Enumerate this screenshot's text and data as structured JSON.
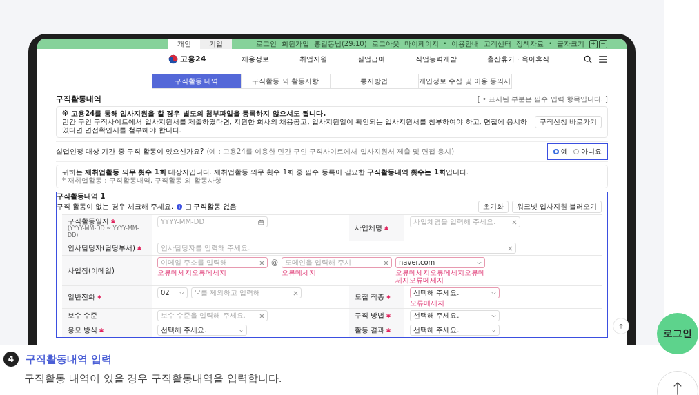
{
  "util_bar": {
    "tabs": [
      {
        "label": "개인",
        "selected": true
      },
      {
        "label": "기업",
        "selected": false
      }
    ],
    "links": [
      {
        "kind": "link",
        "text": "로그인"
      },
      {
        "kind": "link",
        "text": "회원가입"
      },
      {
        "kind": "link",
        "text": "홍길동님(29:10)"
      },
      {
        "kind": "link",
        "text": "로그아웃"
      },
      {
        "kind": "link",
        "text": "마이페이지"
      },
      {
        "kind": "dot",
        "text": "•"
      },
      {
        "kind": "link",
        "text": "이용안내"
      },
      {
        "kind": "link",
        "text": "고객센터"
      },
      {
        "kind": "link",
        "text": "정책자료"
      },
      {
        "kind": "dot",
        "text": "•"
      },
      {
        "kind": "link",
        "text": "글자크기"
      }
    ],
    "font_buttons": [
      "+",
      "−"
    ]
  },
  "header": {
    "logo": "고용24",
    "nav": [
      "채용정보",
      "취업지원",
      "실업급여",
      "직업능력개발",
      "출산휴가 · 육아휴직"
    ]
  },
  "tabs": [
    {
      "label": "구직활동 내역",
      "selected": true
    },
    {
      "label": "구직활동 외 활동사항",
      "selected": false
    },
    {
      "label": "통지방법",
      "selected": false
    },
    {
      "label": "개인정보 수집 및 이용 동의서",
      "selected": false
    }
  ],
  "section": {
    "title": "구직활동내역",
    "required_note": "[ • 표시된 부분은 필수 입력 항목입니다. ]"
  },
  "notice": {
    "headline": "※ 고용24를 통해 입사지원을 할 경우 별도의 첨부파일을 등록하지 않으셔도 됩니다.",
    "body": "민간 구인 구직사이트에서 입사지원서를 제출하였다면, 지원한 회사의 채용공고, 입사지원일이 확인되는 입사지원서를 첨부하여야 하고, 면접에 응시하였다면 면접확인서를 첨부해야 합니다.",
    "button": "구직신청 바로가기"
  },
  "question": {
    "text": "실업인정 대상 기간 중 구직 활동이 있으신가요?",
    "example": "(예 : 고용24를 이용한 민간 구인 구직사이트에서 입사지원서 제출 및 면접 응시)",
    "options": [
      {
        "label": "예",
        "selected": true
      },
      {
        "label": "아니요",
        "selected": false
      }
    ]
  },
  "info": {
    "text": "귀하는 **재취업활동 의무 횟수 1회** 대상자입니다. 재취업활동 의무 횟수 1회 중 필수 등록이 필요한 **구직활동내역 횟수는 1회**입니다.",
    "footnote": "* 재취업활동 : 구직활동내역, 구직활동 외 활동사항"
  },
  "form": {
    "title": "구직활동내역 1",
    "hint": "구직 활동이 없는 경우 체크해 주세요.",
    "no_activity": {
      "label": "구직활동 없음",
      "checked": false
    },
    "buttons": [
      "초기화",
      "워크넷 입사지원 불러오기"
    ],
    "rows": [
      {
        "cells": [
          {
            "label": "구직활동일자",
            "required": true,
            "sublabel": "(YYYY-MM-DD ~ YYYY-MM-DD)",
            "controls": [
              {
                "kind": "date",
                "placeholder": "YYYY-MM-DD"
              }
            ]
          },
          {
            "label": "사업체명",
            "required": true,
            "controls": [
              {
                "kind": "text",
                "placeholder": "사업체명을 입력해 주세요."
              }
            ]
          }
        ]
      },
      {
        "cells": [
          {
            "label": "인사담당자(담당부서)",
            "required": true,
            "controls": [
              {
                "kind": "text",
                "placeholder": "인사담당자를 입력해 주세요."
              }
            ]
          }
        ]
      },
      {
        "cells": [
          {
            "label": "사업장(이메일)",
            "required": false,
            "controls": [
              {
                "kind": "text",
                "placeholder": "이메일 주소를 입력해",
                "error": "오류메세지오류메세지"
              },
              {
                "kind": "separator",
                "text": "@"
              },
              {
                "kind": "text",
                "placeholder": "도메인을 입력해 주시",
                "error": "오류메세지"
              },
              {
                "kind": "select",
                "value": "naver.com",
                "error": "오류메세지오류메세지오류메세지오류메세지"
              }
            ]
          }
        ]
      },
      {
        "cells": [
          {
            "label": "일반전화",
            "required": true,
            "controls": [
              {
                "kind": "select",
                "value": "02"
              },
              {
                "kind": "text",
                "placeholder": "'-'를 제외하고 입력해"
              }
            ]
          },
          {
            "label": "모집 직종",
            "required": true,
            "controls": [
              {
                "kind": "select",
                "value": "선택해 주세요.",
                "error": "오류메세지"
              }
            ]
          }
        ]
      },
      {
        "cells": [
          {
            "label": "보수 수준",
            "required": false,
            "controls": [
              {
                "kind": "text",
                "placeholder": "보수 수준을 입력해 주세요."
              }
            ]
          },
          {
            "label": "구직 방법",
            "required": true,
            "controls": [
              {
                "kind": "select",
                "value": "선택해 주세요."
              }
            ]
          }
        ]
      },
      {
        "cells": [
          {
            "label": "응모 방식",
            "required": true,
            "controls": [
              {
                "kind": "select",
                "value": "선택해 주세요."
              }
            ]
          },
          {
            "label": "활동 결과",
            "required": true,
            "controls": [
              {
                "kind": "select",
                "value": "선택해 주세요."
              }
            ]
          }
        ]
      }
    ]
  },
  "step": {
    "number": "4",
    "title": "구직활동내역 입력",
    "description": "구직활동 내역이 있을 경우 구직활동내역을 입력합니다."
  },
  "login_button": "로그인"
}
